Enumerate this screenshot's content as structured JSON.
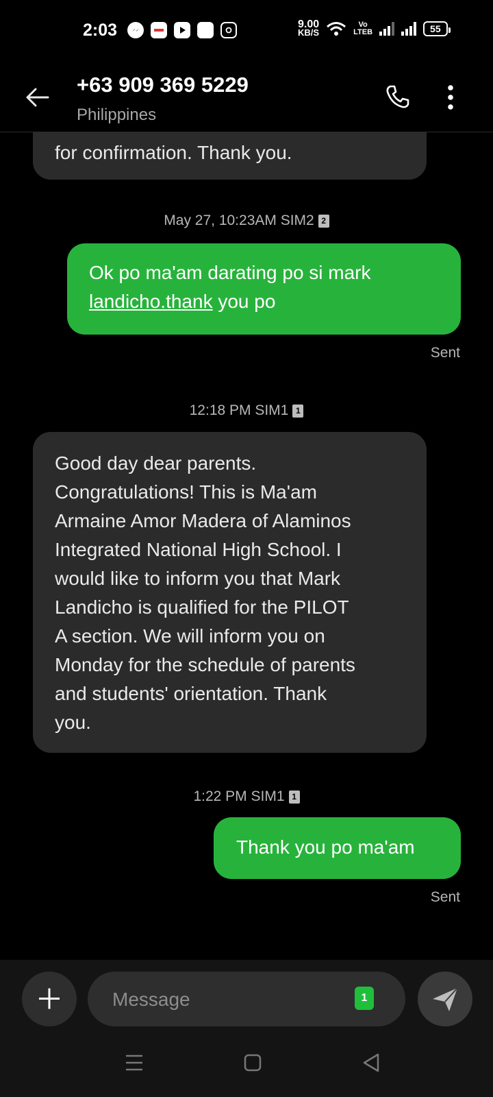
{
  "status_bar": {
    "time": "2:03",
    "net_speed_value": "9.00",
    "net_speed_unit": "KB/S",
    "volte_top": "Vo",
    "volte_bottom": "LTEB",
    "battery": "55"
  },
  "header": {
    "title": "+63 909 369 5229",
    "subtitle": "Philippines"
  },
  "messages": [
    {
      "direction": "incoming",
      "text": "for confirmation. Thank you."
    },
    {
      "timestamp": "May 27, 10:23AM SIM2",
      "sim_badge": "2"
    },
    {
      "direction": "outgoing",
      "text_line1": "Ok po ma'am darating po si mark",
      "link_text": "landicho.thank",
      "text_tail": " you po",
      "status": "Sent"
    },
    {
      "timestamp": "12:18 PM SIM1",
      "sim_badge": "1"
    },
    {
      "direction": "incoming",
      "lines": [
        "Good day dear parents.",
        "Congratulations! This is Ma'am",
        "Armaine Amor Madera of Alaminos",
        "Integrated National High School. I",
        "would like to inform you that Mark",
        "Landicho is qualified for the PILOT",
        "A section. We will inform you on",
        "Monday for the schedule of parents",
        "and students' orientation. Thank",
        "you."
      ]
    },
    {
      "timestamp": "1:22 PM SIM1",
      "sim_badge": "1"
    },
    {
      "direction": "outgoing",
      "text": "Thank you po ma'am",
      "status": "Sent"
    }
  ],
  "composer": {
    "placeholder": "Message",
    "sim_selector": "1"
  },
  "colors": {
    "outgoing_bubble": "#27b33b",
    "incoming_bubble": "#2b2b2b",
    "background": "#000000"
  }
}
